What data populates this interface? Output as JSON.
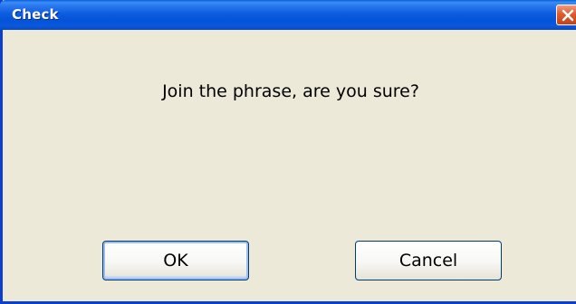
{
  "dialog": {
    "title": "Check",
    "message": "Join the phrase, are you sure?",
    "ok_label": "OK",
    "cancel_label": "Cancel",
    "close_icon": "close-icon"
  },
  "colors": {
    "titlebar": "#0553d8",
    "close_button": "#e25a2c",
    "dialog_background": "#ece9d8",
    "button_border": "#003c74"
  }
}
